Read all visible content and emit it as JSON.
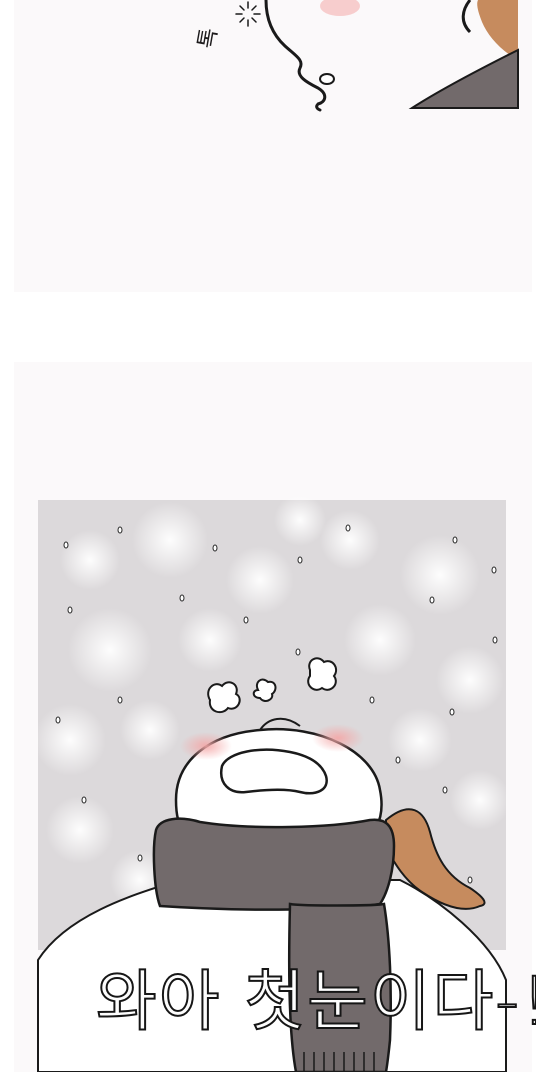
{
  "panels": [
    {
      "sfx_text": "톡"
    },
    {
      "exclamation_text": "와아 첫눈이다-!"
    }
  ],
  "colors": {
    "panel_bg": "#fbf9fa",
    "scarf": "#726a6b",
    "hair": "#c68b5e",
    "snow_bg": "#d9d6d8",
    "blush": "#f6b3b3"
  }
}
